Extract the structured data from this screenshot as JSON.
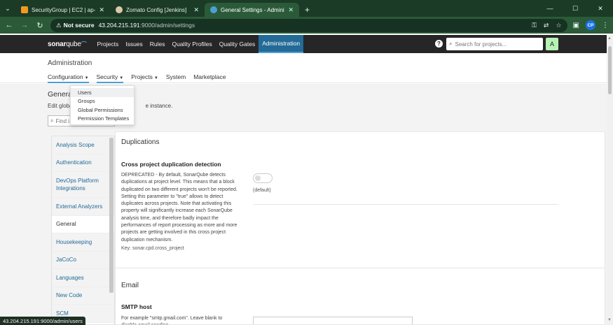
{
  "browser": {
    "tabs": [
      {
        "title": "SecurityGroup | EC2 | ap-south",
        "favicon_color": "#f19a21",
        "active": false
      },
      {
        "title": "Zomato Config [Jenkins]",
        "favicon_color": "#d9c9a8",
        "active": false
      },
      {
        "title": "General Settings - Administrati",
        "favicon_color": "#4b9fd5",
        "active": true
      }
    ],
    "new_tab": "+",
    "security_label": "Not secure",
    "url_host": "43.204.215.191",
    "url_path": ":9000/admin/settings",
    "profile_initials": "CP",
    "status_url": "43.204.215.191:9000/admin/users"
  },
  "nav": {
    "logo_main": "sonar",
    "logo_sub": "qube",
    "items": [
      "Projects",
      "Issues",
      "Rules",
      "Quality Profiles",
      "Quality Gates",
      "Administration"
    ],
    "active": "Administration",
    "help": "?",
    "search_placeholder": "Search for projects...",
    "avatar": "A"
  },
  "admin": {
    "title": "Administration",
    "menu": [
      "Configuration",
      "Security",
      "Projects",
      "System",
      "Marketplace"
    ]
  },
  "dropdown": {
    "items": [
      "Users",
      "Groups",
      "Global Permissions",
      "Permission Templates"
    ]
  },
  "page": {
    "title_visible": "General",
    "desc_left": "Edit globa",
    "desc_right": "e instance.",
    "find_placeholder": "Find i"
  },
  "categories": [
    "Analysis Scope",
    "Authentication",
    "DevOps Platform Integrations",
    "External Analyzers",
    "General",
    "Housekeeping",
    "JaCoCo",
    "Languages",
    "New Code",
    "SCM"
  ],
  "active_category": "General",
  "sections": {
    "duplications": {
      "title": "Duplications",
      "prop_name": "Cross project duplication detection",
      "desc": "DEPRECATED - By default, SonarQube detects duplications at project level. This means that a block duplicated on two different projects won't be reported. Setting this parameter to \"true\" allows to detect duplicates across projects. Note that activating this property will significantly increase each SonarQube analysis time, and therefore badly impact the performances of report processing as more and more projects are getting involved in this cross project duplication mechanism.",
      "key": "Key: sonar.cpd.cross_project",
      "default": "(default)"
    },
    "email": {
      "title": "Email",
      "prop_name": "SMTP host",
      "desc": "For example \"smtp.gmail.com\". Leave blank to disable email sending."
    }
  }
}
